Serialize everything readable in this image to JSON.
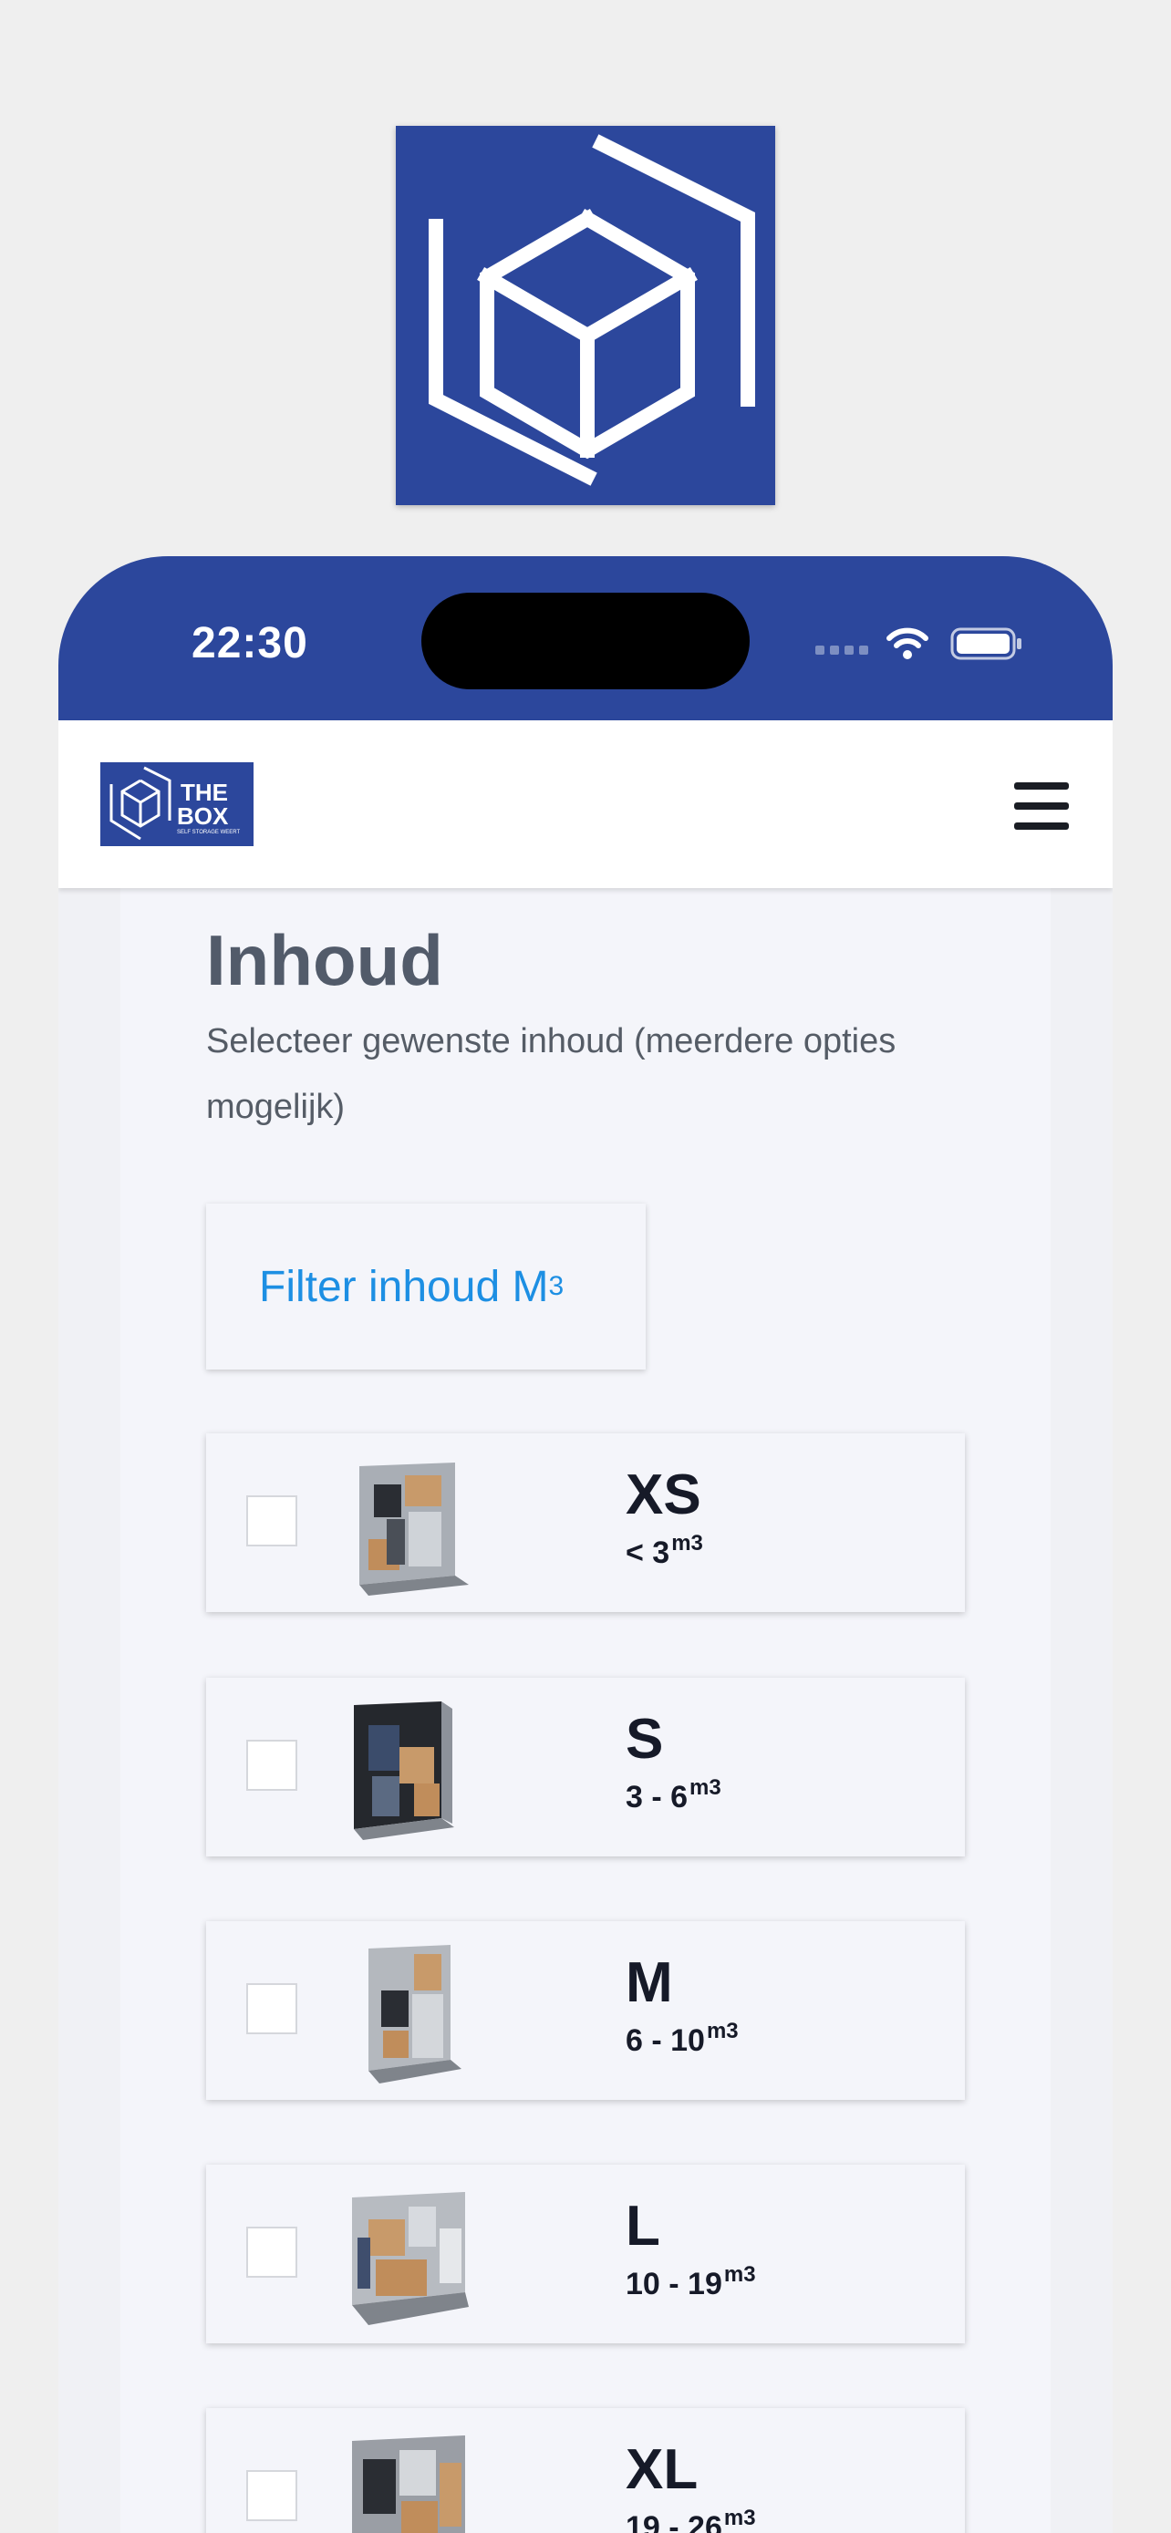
{
  "status_bar": {
    "time": "22:30"
  },
  "colors": {
    "brand": "#2c479c",
    "link": "#1d8fe3",
    "text_dark": "#161a28",
    "heading": "#525b6a"
  },
  "nav": {
    "logo_line1": "THE",
    "logo_line2": "BOX",
    "logo_tagline": "SELF STORAGE WEERT",
    "menu_icon": "hamburger-icon"
  },
  "page": {
    "heading": "Inhoud",
    "subtext": "Selecteer gewenste inhoud (meerdere opties mogelijk)",
    "filter_button": {
      "label": "Filter inhoud M",
      "sup": "3"
    }
  },
  "units": [
    {
      "size": "XS",
      "range": "< 3",
      "unit": "m3",
      "checked": false
    },
    {
      "size": "S",
      "range": "3 - 6",
      "unit": "m3",
      "checked": false
    },
    {
      "size": "M",
      "range": "6 - 10",
      "unit": "m3",
      "checked": false
    },
    {
      "size": "L",
      "range": "10 - 19",
      "unit": "m3",
      "checked": false
    },
    {
      "size": "XL",
      "range": "19 - 26",
      "unit": "m3",
      "checked": false
    }
  ]
}
